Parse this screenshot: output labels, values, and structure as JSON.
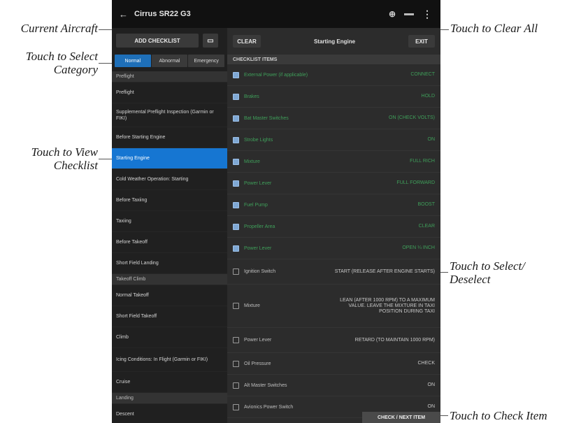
{
  "callouts": {
    "current_aircraft": "Current Aircraft",
    "select_category_1": "Touch to Select",
    "select_category_2": "Category",
    "view_checklist_1": "Touch to View",
    "view_checklist_2": "Checklist",
    "clear_all": "Touch to Clear All",
    "select_deselect_1": "Touch to Select/",
    "select_deselect_2": "Deselect",
    "check_item": "Touch to Check Item"
  },
  "topbar": {
    "back_icon": "back-arrow-icon",
    "title": "Cirrus SR22 G3",
    "icons": [
      "plug-icon",
      "connection-icon",
      "overflow-menu-icon"
    ]
  },
  "left": {
    "add_label": "ADD CHECKLIST",
    "edit_icon": "edit-icon",
    "tabs": [
      "Normal",
      "Abnormal",
      "Emergency"
    ],
    "rows": [
      {
        "label": "Preflight",
        "kind": "section"
      },
      {
        "label": "Preflight",
        "kind": "item"
      },
      {
        "label": "Supplemental Preflight Inspection (Garmin or FIKI)",
        "kind": "item2"
      },
      {
        "label": "Before Starting Engine",
        "kind": "item"
      },
      {
        "label": "Starting Engine",
        "kind": "selected"
      },
      {
        "label": "Cold Weather Operation: Starting",
        "kind": "item"
      },
      {
        "label": "Before Taxiing",
        "kind": "item"
      },
      {
        "label": "Taxiing",
        "kind": "item"
      },
      {
        "label": "Before Takeoff",
        "kind": "item"
      },
      {
        "label": "Short Field Landing",
        "kind": "item"
      },
      {
        "label": "Takeoff Climb",
        "kind": "section"
      },
      {
        "label": "Normal Takeoff",
        "kind": "item"
      },
      {
        "label": "Short Field Takeoff",
        "kind": "item"
      },
      {
        "label": "Climb",
        "kind": "item"
      },
      {
        "label": "Icing Conditions: In Flight (Garmin or FIKI)",
        "kind": "item2"
      },
      {
        "label": "Cruise",
        "kind": "item"
      },
      {
        "label": "Landing",
        "kind": "section"
      },
      {
        "label": "Descent",
        "kind": "item"
      }
    ]
  },
  "right": {
    "clear_label": "CLEAR",
    "title": "Starting Engine",
    "exit_label": "EXIT",
    "header": "CHECKLIST ITEMS",
    "items": [
      {
        "text": "External Power (if applicable)",
        "value": "CONNECT",
        "checked": true
      },
      {
        "text": "Brakes",
        "value": "HOLD",
        "checked": true
      },
      {
        "text": "Bat Master Switches",
        "value": "ON (CHECK VOLTS)",
        "checked": true
      },
      {
        "text": "Strobe Lights",
        "value": "ON",
        "checked": true
      },
      {
        "text": "Mixture",
        "value": "FULL RICH",
        "checked": true
      },
      {
        "text": "Power Lever",
        "value": "FULL FORWARD",
        "checked": true
      },
      {
        "text": "Fuel Pump",
        "value": "BOOST",
        "checked": true
      },
      {
        "text": "Propeller Area",
        "value": "CLEAR",
        "checked": true
      },
      {
        "text": "Power Lever",
        "value": "OPEN ¼ INCH",
        "checked": true
      },
      {
        "text": "Ignition Switch",
        "value": "START (RELEASE AFTER ENGINE STARTS)",
        "checked": false
      },
      {
        "text": "Mixture",
        "value": "LEAN (AFTER 1000 RPM) TO A MAXIMUM VALUE. LEAVE THE MIXTURE IN TAXI POSITION DURING TAXI",
        "checked": false
      },
      {
        "text": "Power Lever",
        "value": "RETARD (TO MAINTAIN 1000 RPM)",
        "checked": false
      },
      {
        "text": "Oil Pressure",
        "value": "CHECK",
        "checked": false
      },
      {
        "text": "Alt Master Switches",
        "value": "ON",
        "checked": false
      },
      {
        "text": "Avionics Power Switch",
        "value": "ON",
        "checked": false
      }
    ],
    "check_next_label": "CHECK / NEXT ITEM"
  }
}
